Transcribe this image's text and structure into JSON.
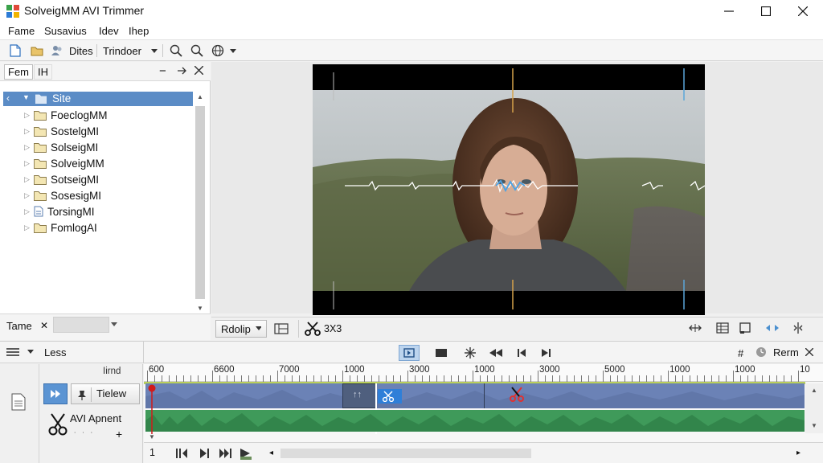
{
  "window": {
    "title": "SolveigMM AVI Trimmer"
  },
  "menu": [
    "Fame",
    "Susavius",
    "Idev",
    "Ihep"
  ],
  "toolbar": {
    "files_label": "Dites",
    "trimmer_label": "Trindoer"
  },
  "left_panel": {
    "tabs": [
      "Fem",
      "IH"
    ],
    "tree": {
      "root": "Site",
      "items": [
        {
          "label": "FoeclogMM",
          "icon": "folder-icon"
        },
        {
          "label": "SostelgMI",
          "icon": "folder-icon"
        },
        {
          "label": "SolseigMI",
          "icon": "folder-icon"
        },
        {
          "label": "SolveigMM",
          "icon": "folder-icon"
        },
        {
          "label": "SotseigMI",
          "icon": "folder-icon"
        },
        {
          "label": "SosesigMI",
          "icon": "folder-icon"
        },
        {
          "label": "TorsingMI",
          "icon": "file-icon"
        },
        {
          "label": "FomlogAI",
          "icon": "folder-icon"
        }
      ]
    },
    "footer_label": "Tame"
  },
  "preview": {
    "dropdown_label": "Rdolip",
    "cut_label": "3X3"
  },
  "timeline": {
    "header_label": "Less",
    "right_label": "Rerm",
    "left_panel": {
      "small_label": "Iirnd",
      "preview_label": "Tielew",
      "append_label": "AVI Apnent"
    },
    "ruler_labels": [
      "600",
      "6600",
      "7000",
      "1000",
      "3000",
      "1000",
      "3000",
      "5000",
      "1000",
      "1000",
      "10"
    ],
    "bottom_label": "1"
  },
  "colors": {
    "accent": "#5b8cc6",
    "video_track": "#6b82b6",
    "audio_track": "#3f9a5a",
    "cut_marker": "#e03131",
    "playhead": "#d11a1a"
  }
}
